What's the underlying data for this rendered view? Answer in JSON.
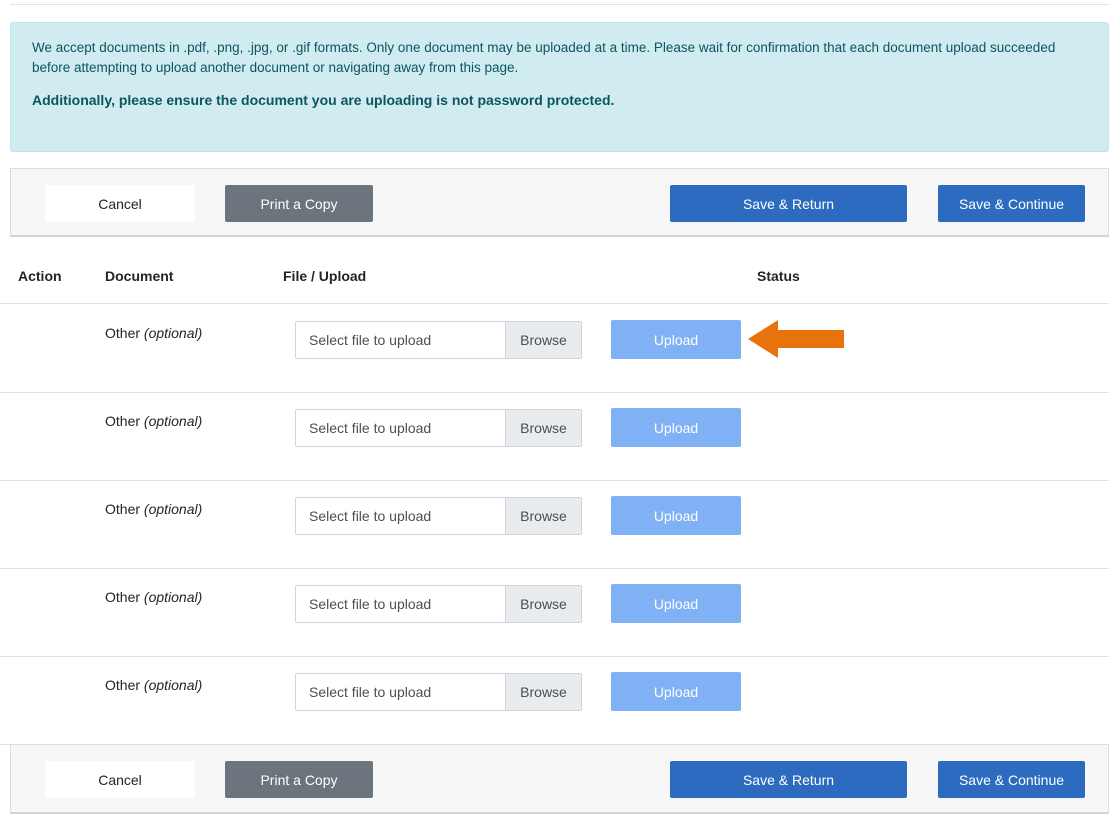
{
  "notice": {
    "line1": "We accept documents in .pdf, .png, .jpg, or .gif formats. Only one document may be uploaded at a time. Please wait for confirmation that each document upload succeeded before attempting to upload another document or navigating away from this page.",
    "line2": "Additionally, please ensure the document you are uploading is not password protected."
  },
  "actions": {
    "cancel": "Cancel",
    "print": "Print a Copy",
    "save_return": "Save & Return",
    "save_continue": "Save & Continue"
  },
  "table": {
    "headers": {
      "action": "Action",
      "document": "Document",
      "file_upload": "File / Upload",
      "status": "Status"
    },
    "rows": [
      {
        "doc_name": "Other",
        "doc_qualifier": "(optional)",
        "file_placeholder": "Select file to upload",
        "browse": "Browse",
        "upload": "Upload"
      },
      {
        "doc_name": "Other",
        "doc_qualifier": "(optional)",
        "file_placeholder": "Select file to upload",
        "browse": "Browse",
        "upload": "Upload"
      },
      {
        "doc_name": "Other",
        "doc_qualifier": "(optional)",
        "file_placeholder": "Select file to upload",
        "browse": "Browse",
        "upload": "Upload"
      },
      {
        "doc_name": "Other",
        "doc_qualifier": "(optional)",
        "file_placeholder": "Select file to upload",
        "browse": "Browse",
        "upload": "Upload"
      },
      {
        "doc_name": "Other",
        "doc_qualifier": "(optional)",
        "file_placeholder": "Select file to upload",
        "browse": "Browse",
        "upload": "Upload"
      }
    ]
  },
  "annotation": {
    "icon": "arrow-left-icon",
    "color": "#e8720c"
  },
  "colors": {
    "primary": "#2c6bbf",
    "secondary": "#6c757d",
    "upload_disabled": "#7fb1f4",
    "info_bg": "#d1ecf1",
    "info_text": "#0c5460"
  }
}
